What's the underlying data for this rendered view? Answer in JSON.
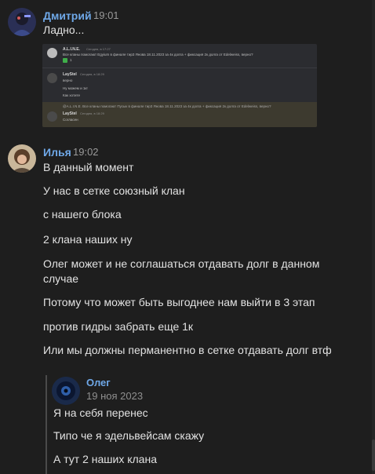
{
  "messages": [
    {
      "author": "Дмитрий",
      "time": "19:01",
      "lines": [
        "Ладно..."
      ],
      "attachment": {
        "rows": [
          {
            "author": "A.L.I.N.E.",
            "time": "Сегодня, в 17:27",
            "text": "Все кланы помогают Egyium в финале тир3 Янова 18.11.2023 за 4к долга + фиксация 2к долга от Edelweiss, верно?",
            "badge": "1"
          },
          {
            "author": "LayStel",
            "time": "Сегодня, в 18:29",
            "texts": [
              "верно",
              "Ну можем и 1к!",
              "Как хотите"
            ]
          },
          {
            "quote": "@A.L.I.N.E. Все кланы помогают Пусык в финале тир3 Янова 18.11.2023 за 4к долга + фиксация 2к долга от Edelweiss, верно?",
            "author": "LayStel",
            "time": "Сегодня, в 18:29",
            "text": "Согласен"
          }
        ]
      }
    },
    {
      "author": "Илья",
      "time": "19:02",
      "lines": [
        "В данный момент",
        "У нас в сетке союзный клан",
        "с нашего блока",
        "2 клана наших ну",
        "Олег может и не соглашаться отдавать долг в данном случае",
        "Потому что может быть выгоднее нам выйти в 3 этап",
        "против гидры забрать еще 1к",
        "Или мы должны перманентно в сетке отдавать долг втф"
      ],
      "quote": {
        "author": "Олег",
        "date": "19 ноя 2023",
        "lines": [
          "Я на себя перенес",
          "Типо че я эдельвейсам скажу",
          "А тут 2 наших клана"
        ]
      }
    }
  ],
  "colors": {
    "background": "#1e1e1e",
    "author": "#6fa8e8",
    "text": "#e2e2e2",
    "time": "#9a9a9a"
  }
}
